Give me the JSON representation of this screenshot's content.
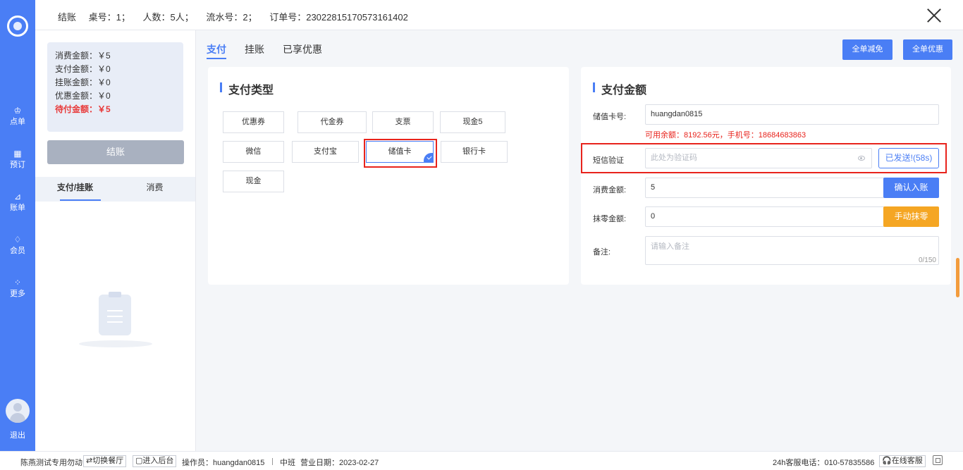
{
  "header": {
    "title": "结账",
    "table": "桌号：1；",
    "people": "人数：5人；",
    "serial": "流水号：2；",
    "order": "订单号：23022815170573161402"
  },
  "nav": {
    "items": [
      {
        "label": "点单",
        "icon": "chef-hat-icon",
        "glyph": "♔"
      },
      {
        "label": "预订",
        "icon": "calendar-icon",
        "glyph": "▦"
      },
      {
        "label": "账单",
        "icon": "chart-icon",
        "glyph": "⊿"
      },
      {
        "label": "会员",
        "icon": "diamond-icon",
        "glyph": "♢"
      },
      {
        "label": "更多",
        "icon": "grid-icon",
        "glyph": "⁘"
      }
    ],
    "logout": "退出"
  },
  "summary": {
    "consume": "消费金额：￥5",
    "paid": "支付金额：￥0",
    "credit": "挂账金额：￥0",
    "discount": "优惠金额：￥0",
    "due": "待付金额：￥5"
  },
  "settle_label": "结账",
  "left_tabs": [
    "支付/挂账",
    "消费"
  ],
  "main_tabs": [
    "支付",
    "挂账",
    "已享优惠"
  ],
  "top_buttons": {
    "reduce_all": "全单减免",
    "discount_all": "全单优惠"
  },
  "payment_type": {
    "title": "支付类型",
    "options": [
      "优惠券",
      "代金券",
      "支票",
      "现金5",
      "微信",
      "支付宝",
      "储值卡",
      "银行卡",
      "现金"
    ],
    "selected": "储值卡"
  },
  "payment_amount": {
    "title": "支付金额",
    "card_label": "储值卡号:",
    "card_value": "huangdan0815",
    "balance_info": "可用余额：8192.56元，手机号：18684683863",
    "sms_label": "短信验证",
    "sms_placeholder": "此处为验证码",
    "sent_label": "已发送!(58s)",
    "consume_label": "消费金额:",
    "consume_value": "5",
    "confirm_label": "确认入账",
    "rounding_label": "抹零金额:",
    "rounding_value": "0",
    "manual_round_label": "手动抹零",
    "remark_label": "备注:",
    "remark_placeholder": "请输入备注",
    "remark_count": "0/150"
  },
  "footer": {
    "store": "陈燕测试专用勿动",
    "switch_label": "⇄切换餐厅",
    "backend_label": "▢进入后台",
    "operator": "操作员：huangdan0815",
    "shift": "中班",
    "biz_date": "营业日期：2023-02-27",
    "hotline": "24h客服电话：010-57835586",
    "online_service": "🎧在线客服"
  },
  "colors": {
    "accent": "#4a7ef5",
    "warning": "#f5a623",
    "danger": "#e8231c"
  }
}
